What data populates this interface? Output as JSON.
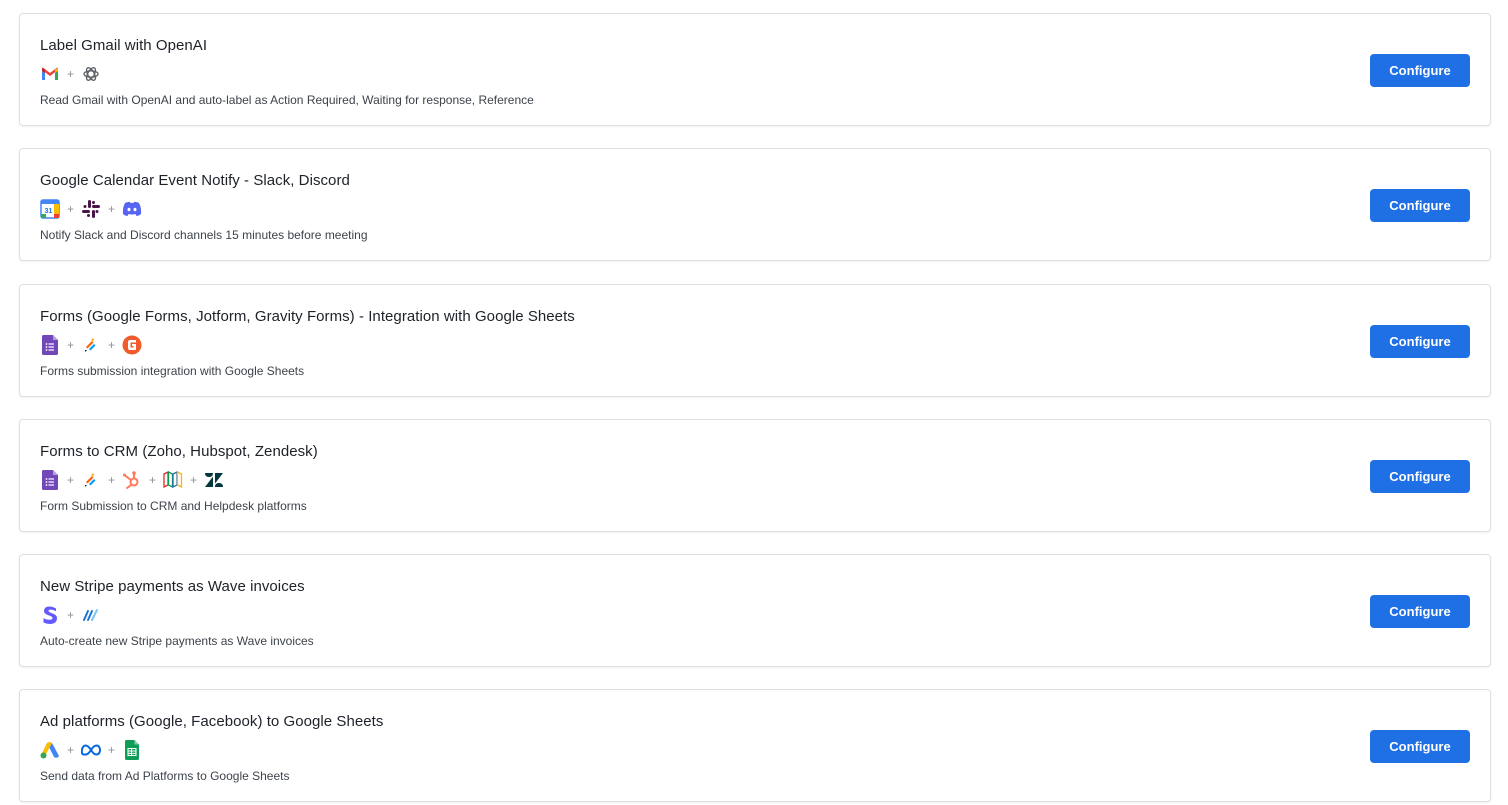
{
  "plus_sign": "+",
  "button_label": "Configure",
  "colors": {
    "button_bg": "#1f6fe5",
    "card_border": "#dcdfe4"
  },
  "workflows": [
    {
      "title": "Label Gmail with OpenAI",
      "apps": [
        "gmail-icon",
        "openai-icon"
      ],
      "description": "Read Gmail with OpenAI and auto-label as Action Required, Waiting for response, Reference"
    },
    {
      "title": "Google Calendar Event Notify - Slack, Discord",
      "apps": [
        "google-calendar-icon",
        "slack-icon",
        "discord-icon"
      ],
      "calendar_icon_text": "31",
      "description": "Notify Slack and Discord channels 15 minutes before meeting"
    },
    {
      "title": "Forms (Google Forms, Jotform, Gravity Forms) - Integration with Google Sheets",
      "apps": [
        "google-forms-icon",
        "jotform-icon",
        "gravity-forms-icon"
      ],
      "description": "Forms submission integration with Google Sheets"
    },
    {
      "title": "Forms to CRM (Zoho, Hubspot, Zendesk)",
      "apps": [
        "google-forms-icon",
        "jotform-icon",
        "hubspot-icon",
        "zoho-icon",
        "zendesk-icon"
      ],
      "description": "Form Submission to CRM and Helpdesk platforms"
    },
    {
      "title": "New Stripe payments as Wave invoices",
      "apps": [
        "stripe-icon",
        "wave-icon"
      ],
      "description": "Auto-create new Stripe payments as Wave invoices"
    },
    {
      "title": "Ad platforms (Google, Facebook) to Google Sheets",
      "apps": [
        "google-ads-icon",
        "meta-icon",
        "google-sheets-icon"
      ],
      "description": "Send data from Ad Platforms to Google Sheets"
    }
  ]
}
